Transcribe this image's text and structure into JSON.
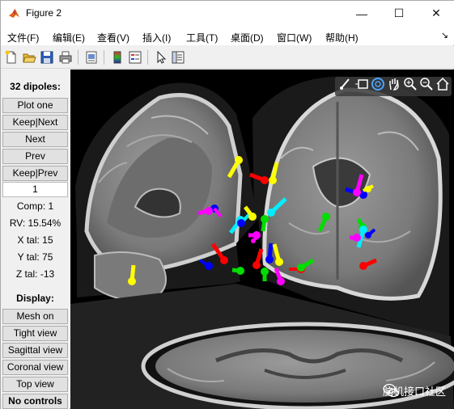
{
  "window": {
    "title": "Figure 2",
    "controls": [
      "—",
      "☐",
      "✕"
    ]
  },
  "menubar": {
    "items": [
      "文件(F)",
      "编辑(E)",
      "查看(V)",
      "插入(I)",
      "工具(T)",
      "桌面(D)",
      "窗口(W)",
      "帮助(H)"
    ],
    "dock_glyph": "↘"
  },
  "toolbar": {
    "icons": [
      "new-figure-icon",
      "open-file-icon",
      "save-icon",
      "print-icon",
      "print-preview-icon",
      "colorbar-icon",
      "legend-icon",
      "pointer-icon",
      "property-inspector-icon"
    ]
  },
  "panel": {
    "header": "32 dipoles:",
    "buttons_top": [
      "Plot one",
      "Keep|Next",
      "Next",
      "Prev",
      "Keep|Prev"
    ],
    "component_index": "1",
    "info": {
      "comp": "Comp: 1",
      "rv": "RV: 15.54%",
      "x_tal": "X tal: 15",
      "y_tal": "Y tal: 75",
      "z_tal": "Z tal: -13"
    },
    "display_header": "Display:",
    "buttons_display": [
      "Mesh on",
      "Tight view",
      "Sagittal view",
      "Coronal view",
      "Top view",
      "No controls"
    ]
  },
  "axes_toolbar": {
    "icons": [
      "brush-icon",
      "datatip-icon",
      "rotate-icon",
      "pan-icon",
      "zoom-in-icon",
      "zoom-out-icon",
      "home-icon"
    ]
  },
  "colors": {
    "yellow": "#ffff00",
    "red": "#ff0000",
    "blue": "#0000ff",
    "green": "#00e000",
    "cyan": "#00e5ff",
    "magenta": "#ff00ff"
  },
  "watermark": {
    "text": "脑机接口社区"
  }
}
